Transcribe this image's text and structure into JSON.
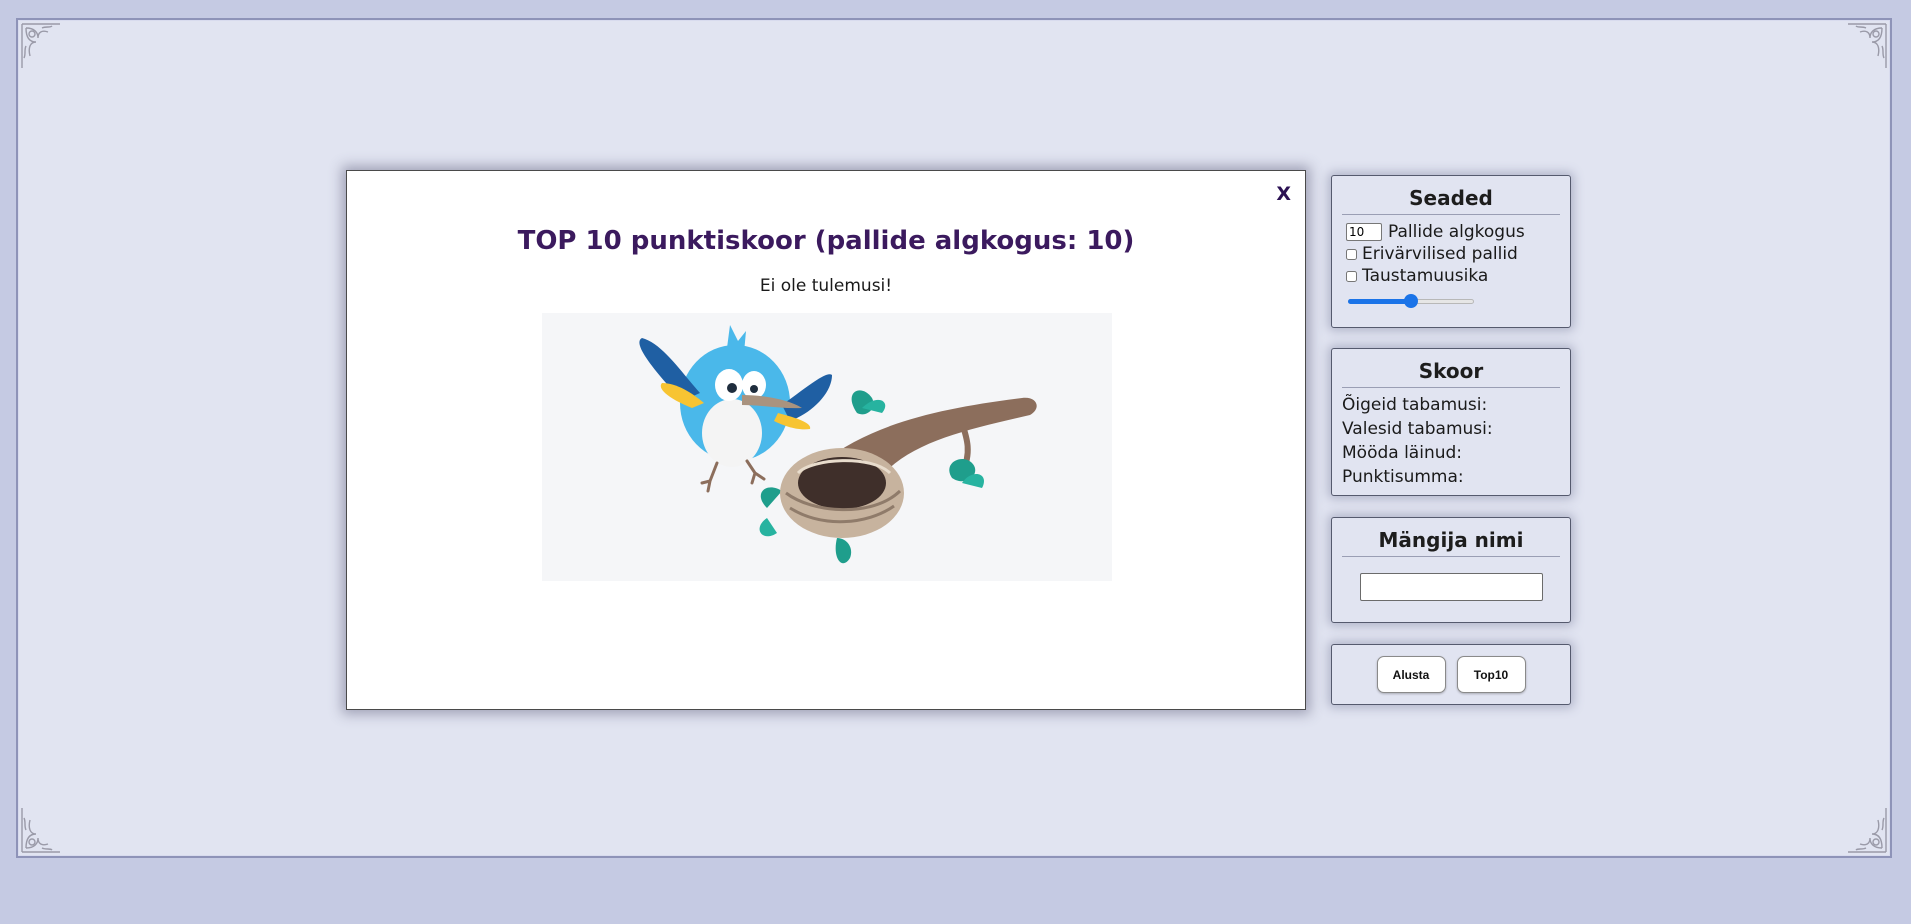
{
  "modal": {
    "close_label": "X",
    "title": "TOP 10 punktiskoor (pallide algkogus: 10)",
    "empty_text": "Ei ole tulemusi!",
    "image_icon": "bird-with-nest-illustration"
  },
  "settings": {
    "heading": "Seaded",
    "ball_count_value": "10",
    "ball_count_label": "Pallide algkogus",
    "colored_balls_label": "Erivärvilised pallid",
    "colored_balls_checked": false,
    "music_label": "Taustamuusika",
    "music_checked": false,
    "volume_fraction": 0.5
  },
  "score": {
    "heading": "Skoor",
    "correct_label": "Õigeid tabamusi:",
    "wrong_label": "Valesid tabamusi:",
    "missed_label": "Mööda läinud:",
    "total_label": "Punktisumma:"
  },
  "player": {
    "heading": "Mängija nimi",
    "name_value": ""
  },
  "actions": {
    "start_label": "Alusta",
    "top10_label": "Top10"
  },
  "colors": {
    "page_background": "#c5cae3",
    "frame_background": "#e1e4f1",
    "title_color": "#3b1a5e",
    "slider_accent": "#1a73e8"
  }
}
